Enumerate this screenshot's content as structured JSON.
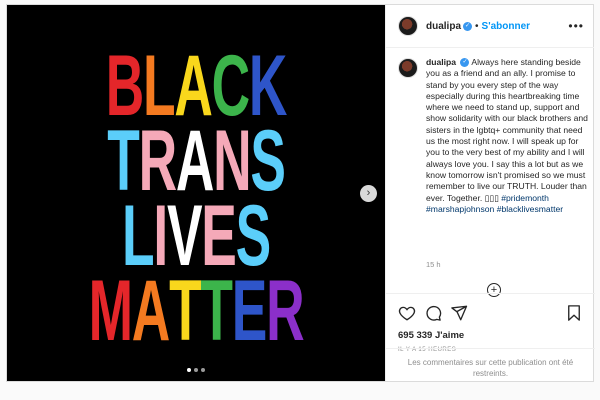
{
  "poster": {
    "lines": [
      {
        "letters": [
          {
            "t": "B",
            "c": "#e4262a"
          },
          {
            "t": "L",
            "c": "#f47a20"
          },
          {
            "t": "A",
            "c": "#f9d71c"
          },
          {
            "t": "C",
            "c": "#3cb44b"
          },
          {
            "t": "K",
            "c": "#2e55c9"
          }
        ]
      },
      {
        "letters": [
          {
            "t": "T",
            "c": "#5bcefa"
          },
          {
            "t": "R",
            "c": "#f5a9b8"
          },
          {
            "t": "A",
            "c": "#ffffff"
          },
          {
            "t": "N",
            "c": "#f5a9b8"
          },
          {
            "t": "S",
            "c": "#5bcefa"
          }
        ]
      },
      {
        "letters": [
          {
            "t": "L",
            "c": "#5bcefa"
          },
          {
            "t": "I",
            "c": "#f5a9b8"
          },
          {
            "t": "V",
            "c": "#ffffff"
          },
          {
            "t": "E",
            "c": "#f5a9b8"
          },
          {
            "t": "S",
            "c": "#5bcefa"
          }
        ]
      },
      {
        "letters": [
          {
            "t": "M",
            "c": "#e4262a"
          },
          {
            "t": "A",
            "c": "#f47a20"
          },
          {
            "t": "T",
            "c": "#f9d71c"
          },
          {
            "t": "T",
            "c": "#3cb44b"
          },
          {
            "t": "E",
            "c": "#2e55c9"
          },
          {
            "t": "R",
            "c": "#8b2fc9"
          }
        ]
      }
    ]
  },
  "header": {
    "username": "dualipa",
    "separator": "•",
    "follow_label": "S'abonner",
    "more_label": "•••"
  },
  "caption": {
    "username": "dualipa",
    "text": "Always here standing beside you as a friend and an ally. I promise to stand by you every step of the way especially during this heartbreaking time where we need to stand up, support and show solidarity with our black brothers and sisters in the lgbtq+ community that need us the most right now. I will speak up for you to the very best of my ability and I will always love you. I say this a lot but as we know tomorrow isn't promised so we must remember to live our TRUTH. Louder than ever. Together.",
    "emojis": "▯▯▯",
    "hashtags": [
      "#pridemonth",
      "#marshapjohnson",
      "#blacklivesmatter"
    ],
    "time": "15 h"
  },
  "actions": {
    "likes": "695 339 J'aime",
    "ago": "IL Y A 15 HEURES"
  },
  "comments_off": "Les commentaires sur cette publication ont été restreints."
}
